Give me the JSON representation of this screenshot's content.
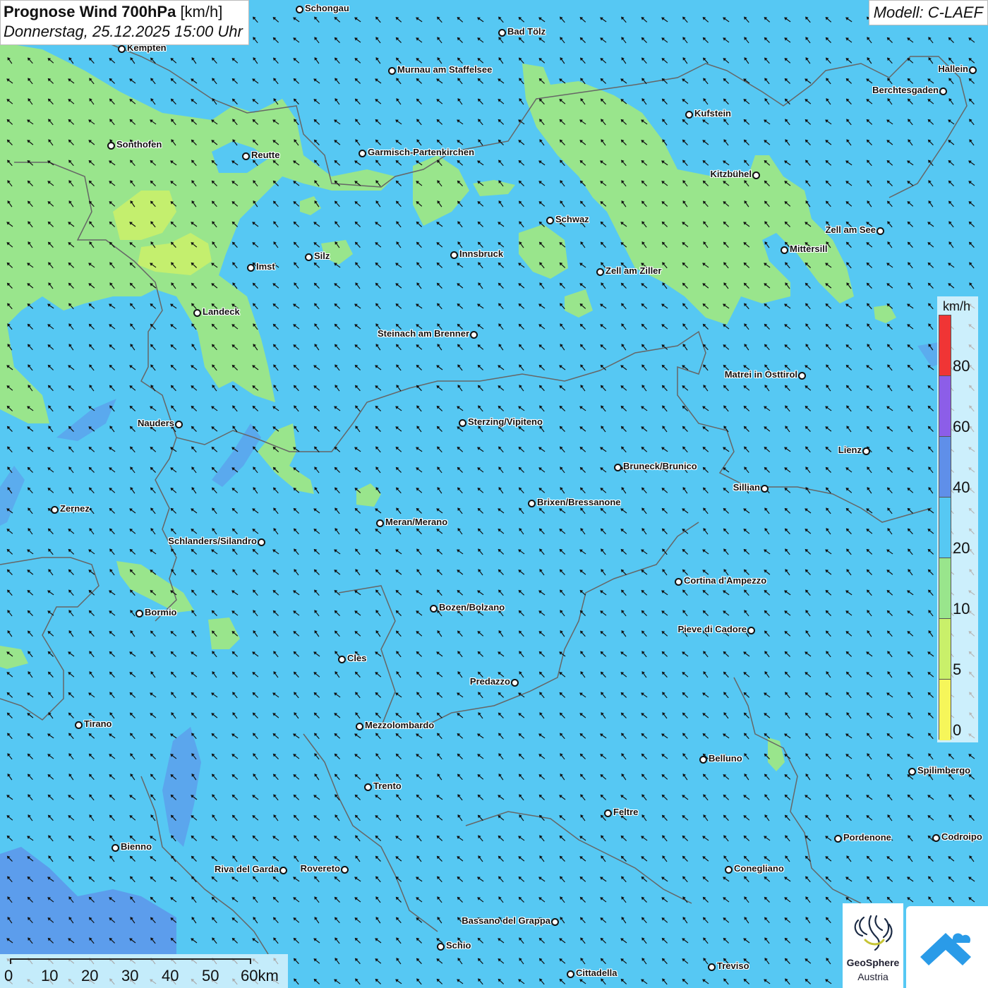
{
  "header": {
    "title_bold": "Prognose Wind 700hPa",
    "title_unit": "[km/h]",
    "datetime": "Donnerstag, 25.12.2025 15:00 Uhr",
    "model": "Modell: C-LAEF"
  },
  "colors": {
    "base": "#56c8f3",
    "wind_0_5": "#f6f65a",
    "wind_5_10": "#c9f06a",
    "wind_10_20": "#99e58c",
    "wind_20_40": "#56c8f3",
    "wind_40_60": "#5f8fe9",
    "wind_60_80": "#8c5ee8",
    "wind_80_plus": "#f03535",
    "border": "#666666",
    "arrow": "#111111"
  },
  "wind_direction": "north-west",
  "legend": {
    "unit": "km/h",
    "labels": [
      "80",
      "60",
      "40",
      "20",
      "10",
      "5",
      "0"
    ]
  },
  "scale_bar": {
    "labels": [
      "0",
      "10",
      "20",
      "30",
      "40",
      "50",
      "60km"
    ]
  },
  "logos": {
    "geosphere_name": "GeoSphere",
    "geosphere_sub": "Austria",
    "geosphere_icon": "geosphere-logo-icon",
    "app_icon": "warnapp-logo-icon"
  },
  "cities": [
    {
      "name": "Schongau",
      "label_side": "right"
    },
    {
      "name": "Bad Tölz",
      "label_side": "right"
    },
    {
      "name": "Kempten",
      "label_side": "right"
    },
    {
      "name": "Murnau am Staffelsee",
      "label_side": "right"
    },
    {
      "name": "Hallein",
      "label_side": "left"
    },
    {
      "name": "Berchtesgaden",
      "label_side": "left"
    },
    {
      "name": "Kufstein",
      "label_side": "right"
    },
    {
      "name": "Sonthofen",
      "label_side": "right"
    },
    {
      "name": "Reutte",
      "label_side": "right"
    },
    {
      "name": "Garmisch-Partenkirchen",
      "label_side": "right"
    },
    {
      "name": "Kitzbühel",
      "label_side": "left"
    },
    {
      "name": "Schwaz",
      "label_side": "right"
    },
    {
      "name": "Zell am See",
      "label_side": "left"
    },
    {
      "name": "Mittersill",
      "label_side": "right"
    },
    {
      "name": "Silz",
      "label_side": "right"
    },
    {
      "name": "Innsbruck",
      "label_side": "right"
    },
    {
      "name": "Imst",
      "label_side": "right"
    },
    {
      "name": "Zell am Ziller",
      "label_side": "right"
    },
    {
      "name": "Landeck",
      "label_side": "right"
    },
    {
      "name": "Steinach am Brenner",
      "label_side": "left"
    },
    {
      "name": "Matrei in Osttirol",
      "label_side": "left"
    },
    {
      "name": "Nauders",
      "label_side": "left"
    },
    {
      "name": "Sterzing/Vipiteno",
      "label_side": "right"
    },
    {
      "name": "Lienz",
      "label_side": "left"
    },
    {
      "name": "Bruneck/Brunico",
      "label_side": "right"
    },
    {
      "name": "Sillian",
      "label_side": "left"
    },
    {
      "name": "Zernez",
      "label_side": "right"
    },
    {
      "name": "Brixen/Bressanone",
      "label_side": "right"
    },
    {
      "name": "Meran/Merano",
      "label_side": "right"
    },
    {
      "name": "Schlanders/Silandro",
      "label_side": "left"
    },
    {
      "name": "Cortina d'Ampezzo",
      "label_side": "right"
    },
    {
      "name": "Bozen/Bolzano",
      "label_side": "right"
    },
    {
      "name": "Bormio",
      "label_side": "right"
    },
    {
      "name": "Pieve di Cadore",
      "label_side": "left"
    },
    {
      "name": "Cles",
      "label_side": "right"
    },
    {
      "name": "Predazzo",
      "label_side": "left"
    },
    {
      "name": "Tirano",
      "label_side": "right"
    },
    {
      "name": "Mezzolombardo",
      "label_side": "right"
    },
    {
      "name": "Belluno",
      "label_side": "right"
    },
    {
      "name": "Spilimbergo",
      "label_side": "right"
    },
    {
      "name": "Trento",
      "label_side": "right"
    },
    {
      "name": "Feltre",
      "label_side": "right"
    },
    {
      "name": "Pordenone",
      "label_side": "right"
    },
    {
      "name": "Codroipo",
      "label_side": "right"
    },
    {
      "name": "Bienno",
      "label_side": "right"
    },
    {
      "name": "Riva del Garda",
      "label_side": "left"
    },
    {
      "name": "Rovereto",
      "label_side": "left"
    },
    {
      "name": "Conegliano",
      "label_side": "right"
    },
    {
      "name": "Bassano del Grappa",
      "label_side": "left"
    },
    {
      "name": "Schio",
      "label_side": "right"
    },
    {
      "name": "Treviso",
      "label_side": "right"
    },
    {
      "name": "Cittadella",
      "label_side": "right"
    }
  ]
}
